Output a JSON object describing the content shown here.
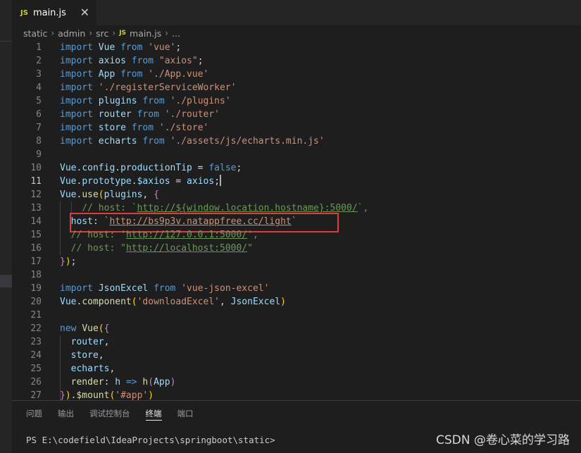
{
  "tab": {
    "badge": "JS",
    "title": "main.js",
    "close": "✕"
  },
  "breadcrumb": {
    "segments": [
      "static",
      "admin",
      "src",
      "main.js",
      "..."
    ],
    "badge": "JS",
    "sep": "›"
  },
  "editor": {
    "active_line": 11,
    "lines": [
      {
        "n": "1",
        "t": [
          [
            "kw",
            "import"
          ],
          [
            "pl",
            " "
          ],
          [
            "id",
            "Vue"
          ],
          [
            "pl",
            " "
          ],
          [
            "kw",
            "from"
          ],
          [
            "pl",
            " "
          ],
          [
            "str",
            "'vue'"
          ],
          [
            "pl",
            ";"
          ]
        ]
      },
      {
        "n": "2",
        "t": [
          [
            "kw",
            "import"
          ],
          [
            "pl",
            " "
          ],
          [
            "id",
            "axios"
          ],
          [
            "pl",
            " "
          ],
          [
            "kw",
            "from"
          ],
          [
            "pl",
            " "
          ],
          [
            "str",
            "\"axios\""
          ],
          [
            "pl",
            ";"
          ]
        ]
      },
      {
        "n": "3",
        "t": [
          [
            "kw",
            "import"
          ],
          [
            "pl",
            " "
          ],
          [
            "id",
            "App"
          ],
          [
            "pl",
            " "
          ],
          [
            "kw",
            "from"
          ],
          [
            "pl",
            " "
          ],
          [
            "str",
            "'./App.vue'"
          ]
        ]
      },
      {
        "n": "4",
        "t": [
          [
            "kw",
            "import"
          ],
          [
            "pl",
            " "
          ],
          [
            "str",
            "'./registerServiceWorker'"
          ]
        ]
      },
      {
        "n": "5",
        "t": [
          [
            "kw",
            "import"
          ],
          [
            "pl",
            " "
          ],
          [
            "id",
            "plugins"
          ],
          [
            "pl",
            " "
          ],
          [
            "kw",
            "from"
          ],
          [
            "pl",
            " "
          ],
          [
            "str",
            "'./plugins'"
          ]
        ]
      },
      {
        "n": "6",
        "t": [
          [
            "kw",
            "import"
          ],
          [
            "pl",
            " "
          ],
          [
            "id",
            "router"
          ],
          [
            "pl",
            " "
          ],
          [
            "kw",
            "from"
          ],
          [
            "pl",
            " "
          ],
          [
            "str",
            "'./router'"
          ]
        ]
      },
      {
        "n": "7",
        "t": [
          [
            "kw",
            "import"
          ],
          [
            "pl",
            " "
          ],
          [
            "id",
            "store"
          ],
          [
            "pl",
            " "
          ],
          [
            "kw",
            "from"
          ],
          [
            "pl",
            " "
          ],
          [
            "str",
            "'./store'"
          ]
        ]
      },
      {
        "n": "8",
        "t": [
          [
            "kw",
            "import"
          ],
          [
            "pl",
            " "
          ],
          [
            "id",
            "echarts"
          ],
          [
            "pl",
            " "
          ],
          [
            "kw",
            "from"
          ],
          [
            "pl",
            " "
          ],
          [
            "str",
            "'./assets/js/echarts.min.js'"
          ]
        ]
      },
      {
        "n": "9",
        "t": []
      },
      {
        "n": "10",
        "t": [
          [
            "id",
            "Vue"
          ],
          [
            "pl",
            "."
          ],
          [
            "id",
            "config"
          ],
          [
            "pl",
            "."
          ],
          [
            "id",
            "productionTip"
          ],
          [
            "pl",
            " = "
          ],
          [
            "kw",
            "false"
          ],
          [
            "pl",
            ";"
          ]
        ]
      },
      {
        "n": "11",
        "t": [
          [
            "id",
            "Vue"
          ],
          [
            "pl",
            "."
          ],
          [
            "id",
            "prototype"
          ],
          [
            "pl",
            "."
          ],
          [
            "id",
            "$axios"
          ],
          [
            "pl",
            " = "
          ],
          [
            "id",
            "axios"
          ],
          [
            "pl",
            ";"
          ],
          [
            "cursor",
            ""
          ]
        ]
      },
      {
        "n": "12",
        "t": [
          [
            "id",
            "Vue"
          ],
          [
            "pl",
            "."
          ],
          [
            "fn",
            "use"
          ],
          [
            "br",
            "("
          ],
          [
            "id",
            "plugins"
          ],
          [
            "pl",
            ", "
          ],
          [
            "kc",
            "{"
          ]
        ]
      },
      {
        "n": "13",
        "t": [
          [
            "pl",
            "    "
          ],
          [
            "com",
            "// host: `"
          ],
          [
            "com ul",
            "http://${window.location.hostname}:5000/"
          ],
          [
            "com",
            "`,"
          ]
        ]
      },
      {
        "n": "14",
        "t": [
          [
            "pl",
            "  "
          ],
          [
            "id",
            "host"
          ],
          [
            "pl",
            ": "
          ],
          [
            "str",
            "`"
          ],
          [
            "str ul",
            "http://bs9p3v.natappfree.cc/light"
          ],
          [
            "str",
            "`"
          ]
        ]
      },
      {
        "n": "15",
        "t": [
          [
            "pl",
            "  "
          ],
          [
            "com",
            "// host: '"
          ],
          [
            "com ul",
            "http://127.0.0.1:5000/"
          ],
          [
            "com",
            "',"
          ]
        ]
      },
      {
        "n": "16",
        "t": [
          [
            "pl",
            "  "
          ],
          [
            "com",
            "// host: \""
          ],
          [
            "com ul",
            "http://localhost:5000/"
          ],
          [
            "com",
            "\""
          ]
        ]
      },
      {
        "n": "17",
        "t": [
          [
            "kc",
            "}"
          ],
          [
            "br",
            ")"
          ],
          [
            "pl",
            ";"
          ]
        ]
      },
      {
        "n": "18",
        "t": []
      },
      {
        "n": "19",
        "t": [
          [
            "kw",
            "import"
          ],
          [
            "pl",
            " "
          ],
          [
            "id",
            "JsonExcel"
          ],
          [
            "pl",
            " "
          ],
          [
            "kw",
            "from"
          ],
          [
            "pl",
            " "
          ],
          [
            "str",
            "'vue-json-excel'"
          ]
        ]
      },
      {
        "n": "20",
        "t": [
          [
            "id",
            "Vue"
          ],
          [
            "pl",
            "."
          ],
          [
            "fn",
            "component"
          ],
          [
            "br",
            "("
          ],
          [
            "str",
            "'downloadExcel'"
          ],
          [
            "pl",
            ", "
          ],
          [
            "id",
            "JsonExcel"
          ],
          [
            "br",
            ")"
          ]
        ]
      },
      {
        "n": "21",
        "t": []
      },
      {
        "n": "22",
        "t": [
          [
            "kw",
            "new"
          ],
          [
            "pl",
            " "
          ],
          [
            "fn",
            "Vue"
          ],
          [
            "br",
            "("
          ],
          [
            "kc",
            "{"
          ]
        ]
      },
      {
        "n": "23",
        "t": [
          [
            "pl",
            "  "
          ],
          [
            "id",
            "router"
          ],
          [
            "pl",
            ","
          ]
        ]
      },
      {
        "n": "24",
        "t": [
          [
            "pl",
            "  "
          ],
          [
            "id",
            "store"
          ],
          [
            "pl",
            ","
          ]
        ]
      },
      {
        "n": "25",
        "t": [
          [
            "pl",
            "  "
          ],
          [
            "id",
            "echarts"
          ],
          [
            "pl",
            ","
          ]
        ]
      },
      {
        "n": "26",
        "t": [
          [
            "pl",
            "  "
          ],
          [
            "fn",
            "render"
          ],
          [
            "pl",
            ": "
          ],
          [
            "id",
            "h"
          ],
          [
            "pl",
            " "
          ],
          [
            "kw",
            "=>"
          ],
          [
            "pl",
            " "
          ],
          [
            "fn",
            "h"
          ],
          [
            "kc",
            "("
          ],
          [
            "id",
            "App"
          ],
          [
            "kc",
            ")"
          ]
        ]
      },
      {
        "n": "27",
        "t": [
          [
            "kc",
            "}"
          ],
          [
            "br",
            ")"
          ],
          [
            "pl",
            "."
          ],
          [
            "fn",
            "$mount"
          ],
          [
            "br",
            "("
          ],
          [
            "str",
            "'#app'"
          ],
          [
            "br",
            ")"
          ]
        ]
      }
    ]
  },
  "panel": {
    "tabs": [
      "问题",
      "输出",
      "调试控制台",
      "终端",
      "端口"
    ],
    "active_tab": 3,
    "terminal_line": "PS E:\\codefield\\IdeaProjects\\springboot\\static>"
  },
  "watermark": "CSDN @卷心菜的学习路"
}
